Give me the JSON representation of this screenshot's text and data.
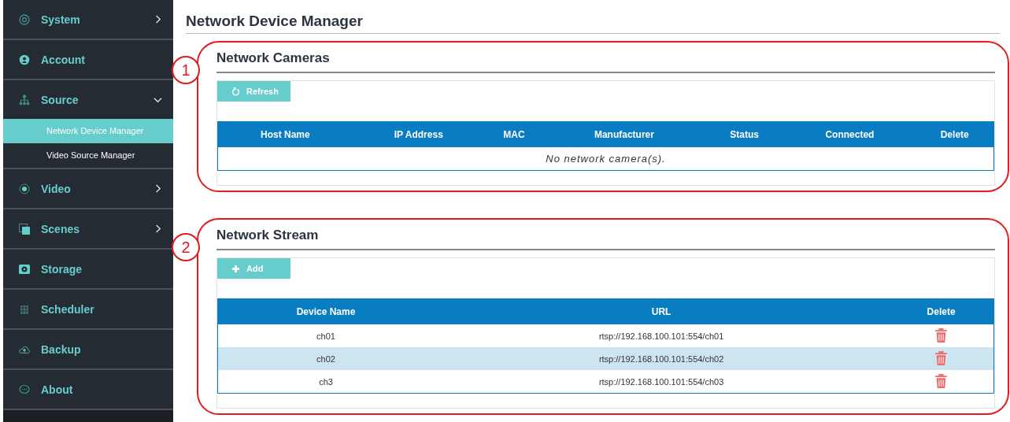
{
  "sidebar": {
    "items": [
      {
        "label": "System",
        "expanded": false
      },
      {
        "label": "Account"
      },
      {
        "label": "Source",
        "expanded": true,
        "children": [
          {
            "label": "Network Device Manager",
            "selected": true
          },
          {
            "label": "Video Source Manager",
            "selected": false
          }
        ]
      },
      {
        "label": "Video",
        "expanded": false
      },
      {
        "label": "Scenes",
        "expanded": false
      },
      {
        "label": "Storage"
      },
      {
        "label": "Scheduler"
      },
      {
        "label": "Backup"
      },
      {
        "label": "About"
      }
    ]
  },
  "page_title": "Network Device Manager",
  "sections": [
    {
      "callout": "1",
      "title": "Network Cameras",
      "button": "Refresh",
      "columns": [
        "Host Name",
        "IP Address",
        "MAC",
        "Manufacturer",
        "Status",
        "Connected",
        "Delete"
      ],
      "empty_message": "No network camera(s)."
    },
    {
      "callout": "2",
      "title": "Network Stream",
      "button": "Add",
      "columns": [
        "Device Name",
        "URL",
        "Delete"
      ],
      "rows": [
        {
          "cells": [
            "ch01",
            "rtsp://192.168.100.101:554/ch01"
          ],
          "selected": false
        },
        {
          "cells": [
            "ch02",
            "rtsp://192.168.100.101:554/ch02"
          ],
          "selected": true
        },
        {
          "cells": [
            "ch3",
            "rtsp://192.168.100.101:554/ch03"
          ],
          "selected": false
        }
      ]
    }
  ]
}
